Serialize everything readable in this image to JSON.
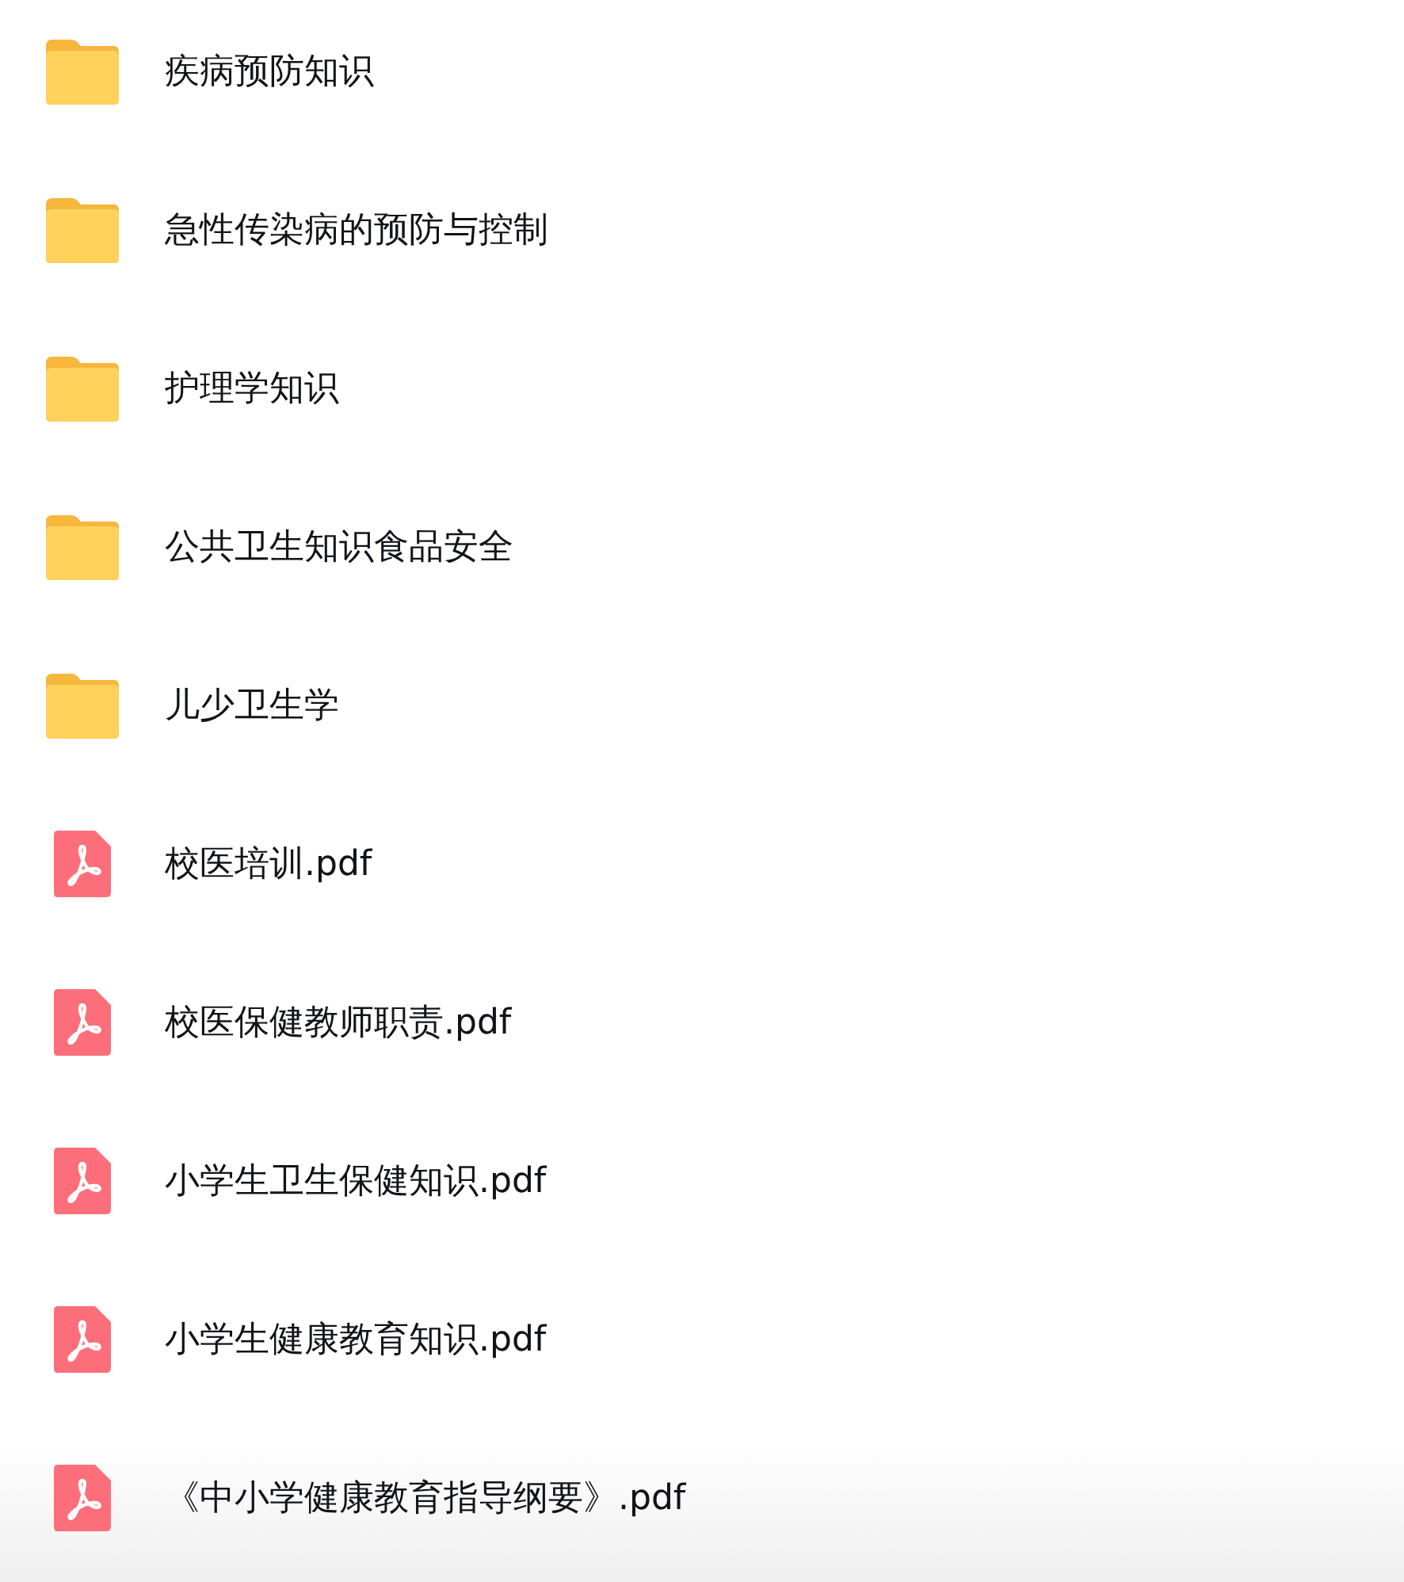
{
  "files": [
    {
      "kind": "folder",
      "name": "疾病预防知识"
    },
    {
      "kind": "folder",
      "name": "急性传染病的预防与控制"
    },
    {
      "kind": "folder",
      "name": "护理学知识"
    },
    {
      "kind": "folder",
      "name": "公共卫生知识食品安全"
    },
    {
      "kind": "folder",
      "name": "儿少卫生学"
    },
    {
      "kind": "pdf",
      "name": "校医培训.pdf"
    },
    {
      "kind": "pdf",
      "name": "校医保健教师职责.pdf"
    },
    {
      "kind": "pdf",
      "name": "小学生卫生保健知识.pdf"
    },
    {
      "kind": "pdf",
      "name": "小学生健康教育知识.pdf"
    },
    {
      "kind": "pdf",
      "name": "《中小学健康教育指导纲要》.pdf"
    }
  ]
}
